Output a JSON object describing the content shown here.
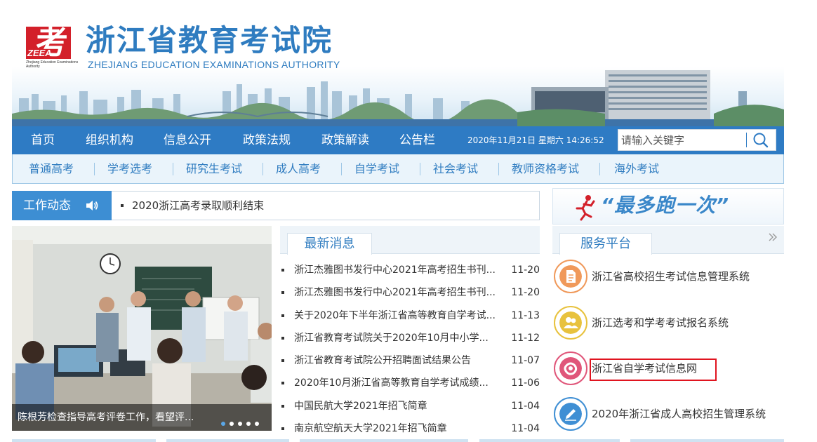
{
  "header": {
    "logo_char": "考",
    "logo_abbr": "ZEEA",
    "logo_sub": "Zhejiang Education Examinations Authority",
    "title": "浙江省教育考试院",
    "subtitle": "ZHEJIANG EDUCATION EXAMINATIONS AUTHORITY"
  },
  "nav": {
    "items": [
      "首页",
      "组织机构",
      "信息公开",
      "政策法规",
      "政策解读",
      "公告栏"
    ],
    "datetime": "2020年11月21日 星期六 14:26:52",
    "search_placeholder": "请输入关键字"
  },
  "subnav": {
    "items": [
      "普通高考",
      "学考选考",
      "研究生考试",
      "成人高考",
      "自学考试",
      "社会考试",
      "教师资格考试",
      "海外考试"
    ]
  },
  "work_news": {
    "label": "工作动态",
    "headline": "2020浙江高考录取顺利结束"
  },
  "promo": {
    "text": "“最多跑一次”"
  },
  "slider": {
    "caption": "陈根芳检查指导高考评卷工作，看望评...",
    "slide_count": 5,
    "active_index": 0
  },
  "latest_news": {
    "tab": "最新消息",
    "items": [
      {
        "title": "浙江杰雅图书发行中心2021年高考招生书刊...",
        "date": "11-20"
      },
      {
        "title": "浙江杰雅图书发行中心2021年高考招生书刊...",
        "date": "11-20"
      },
      {
        "title": "关于2020年下半年浙江省高等教育自学考试...",
        "date": "11-13"
      },
      {
        "title": "浙江省教育考试院关于2020年10月中小学...",
        "date": "11-12"
      },
      {
        "title": "浙江省教育考试院公开招聘面试结果公告",
        "date": "11-07"
      },
      {
        "title": "2020年10月浙江省高等教育自学考试成绩...",
        "date": "11-06"
      },
      {
        "title": "中国民航大学2021年招飞简章",
        "date": "11-04"
      },
      {
        "title": "南京航空航天大学2021年招飞简章",
        "date": "11-04"
      }
    ]
  },
  "service": {
    "tab": "服务平台",
    "items": [
      {
        "label": "浙江省高校招生考试信息管理系统",
        "icon": "document-icon",
        "color": "#f0995a"
      },
      {
        "label": "浙江选考和学考考试报名系统",
        "icon": "users-icon",
        "color": "#e8c23d"
      },
      {
        "label": "浙江省自学考试信息网",
        "icon": "network-icon",
        "color": "#e0567a"
      },
      {
        "label": "2020年浙江省成人高校招生管理系统",
        "icon": "pencil-icon",
        "color": "#3f8fd4"
      }
    ]
  },
  "colors": {
    "nav_bg": "#2e7bc4",
    "accent": "#2f7cc0",
    "highlight_box": "#e0141f"
  }
}
